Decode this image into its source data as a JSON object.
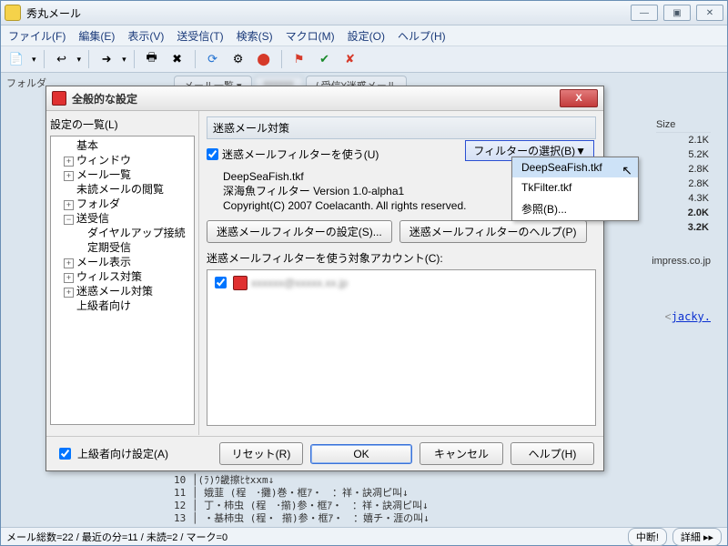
{
  "app": {
    "title": "秀丸メール"
  },
  "menu": {
    "file": "ファイル(F)",
    "edit": "編集(E)",
    "view": "表示(V)",
    "sendrecv": "送受信(T)",
    "search": "検索(S)",
    "macro": "マクロ(M)",
    "settings": "設定(O)",
    "help": "ヘルプ(H)"
  },
  "folder_label": "フォルダ",
  "tabs": {
    "maillist": "メール一覧 ▾",
    "path": "受信¥迷惑メール"
  },
  "size_header": "Size",
  "sizes": [
    "2.1K",
    "5.2K",
    "2.8K",
    "2.8K",
    "4.3K",
    "2.0K",
    "3.2K"
  ],
  "domain_text": "impress.co.jp",
  "jacky": "jacky.",
  "bodylines": "10 │(ﾗ)ｳ畿擦ﾋｾxxm↓\n11 │ 娥韮 (程　･攤)巻・框ｱ・　：祥・訣凋ピ叫↓\n12 │ 丁・柿虫 (程　･擶)参・框ｱ・　：祥・訣凋ピ叫↓\n13 │ ・基柿虫 (程・ 擶)参・框ｱ・　：嬉チ・涯の叫↓",
  "statusbar": {
    "text": "メール総数=22 / 最近の分=11 / 未読=2 / マーク=0",
    "stop": "中断!",
    "detail": "詳細 ▸▸"
  },
  "dialog": {
    "title": "全般的な設定",
    "tree_label": "設定の一覧(L)",
    "nodes": {
      "basic": "基本",
      "window": "ウィンドウ",
      "maillist": "メール一覧",
      "unread": "未読メールの閲覧",
      "folder": "フォルダ",
      "sendrecv": "送受信",
      "dialup": "ダイヤルアップ接続",
      "periodic": "定期受信",
      "maildisp": "メール表示",
      "virus": "ウィルス対策",
      "spam": "迷惑メール対策",
      "advanced": "上級者向け"
    },
    "pane_title": "迷惑メール対策",
    "use_filter": "迷惑メールフィルターを使う(U)",
    "filter_select": "フィルターの選択(B)▼",
    "desc": {
      "name": "DeepSeaFish.tkf",
      "line1": "深海魚フィルター Version 1.0-alpha1",
      "line2": "Copyright(C) 2007 Coelacanth.  All rights reserved."
    },
    "btn_settings": "迷惑メールフィルターの設定(S)...",
    "btn_help": "迷惑メールフィルターのヘルプ(P)",
    "acct_label": "迷惑メールフィルターを使う対象アカウント(C):",
    "acct_item": "xxxxxx@xxxxx.xx.jp",
    "adv_chk": "上級者向け設定(A)",
    "reset": "リセット(R)",
    "ok": "OK",
    "cancel": "キャンセル",
    "helpbtn": "ヘルプ(H)"
  },
  "dropdown": {
    "item1": "DeepSeaFish.tkf",
    "item2": "TkFilter.tkf",
    "item3": "参照(B)..."
  }
}
